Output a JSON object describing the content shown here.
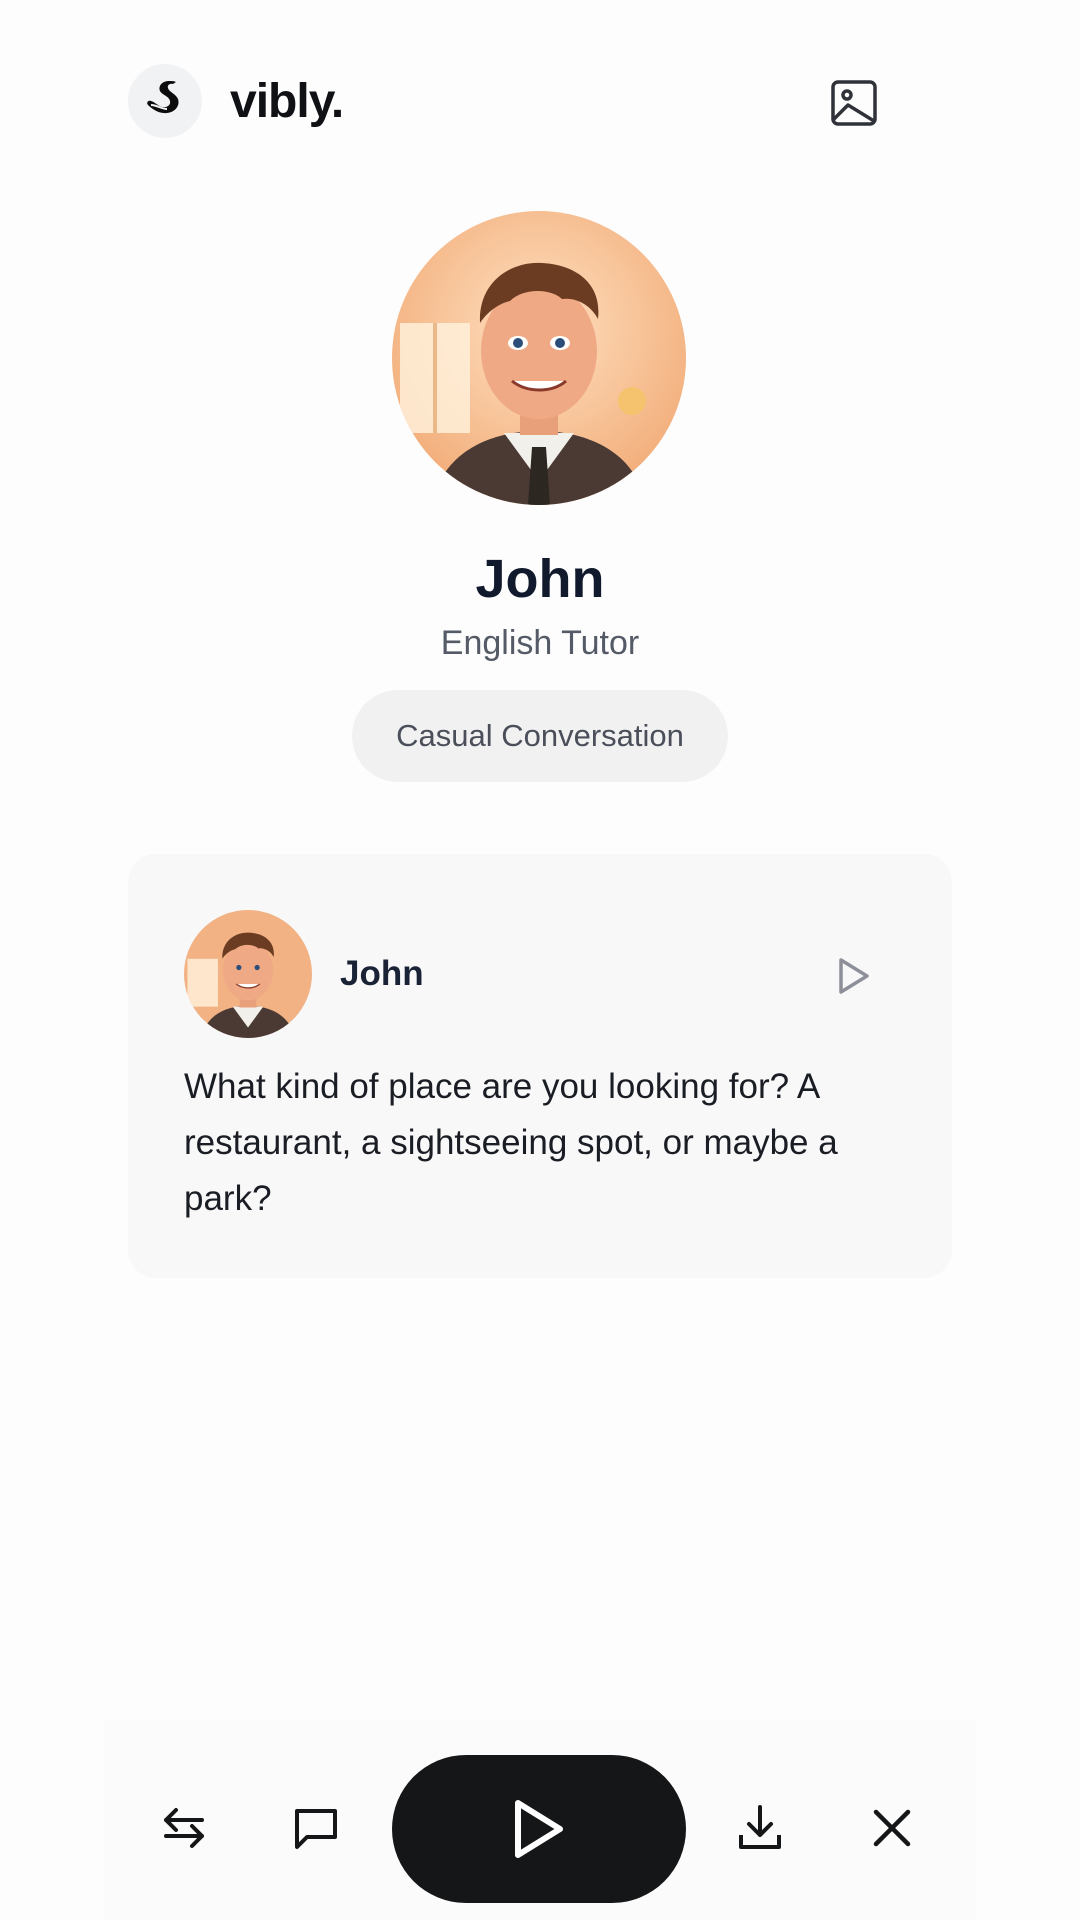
{
  "header": {
    "brand": "vibly.",
    "logo_icon": "swan-icon",
    "image_button_icon": "image-icon"
  },
  "profile": {
    "name": "John",
    "role": "English Tutor",
    "mode_chip": "Casual Conversation"
  },
  "message": {
    "sender": "John",
    "text": "What kind of place are you looking for? A restaurant, a sightseeing spot, or maybe a park?",
    "play_icon": "play-icon"
  },
  "toolbar": {
    "icons": [
      "swap-icon",
      "chat-bubble-icon",
      "play-icon",
      "download-icon",
      "close-icon"
    ]
  },
  "colors": {
    "accent_dark": "#151617",
    "card_bg": "#f8f8f9",
    "chip_bg": "#f1f1f2"
  }
}
